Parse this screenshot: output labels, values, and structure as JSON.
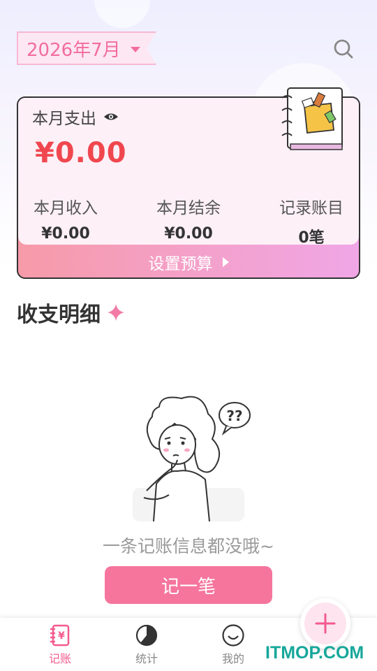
{
  "header": {
    "month": "2026年7月",
    "search_icon": "search-icon"
  },
  "summary": {
    "expense_label": "本月支出",
    "expense_value": "¥0.00",
    "income_label": "本月收入",
    "income_value": "¥0.00",
    "balance_label": "本月结余",
    "balance_value": "¥0.00",
    "records_label": "记录账目",
    "records_value": "0笔",
    "budget_label": "设置预算"
  },
  "details": {
    "title": "收支明细"
  },
  "empty_state": {
    "message": "一条记账信息都没哦~",
    "record_button": "记一笔"
  },
  "nav": {
    "items": [
      {
        "label": "记账",
        "icon": "ledger-icon",
        "active": true
      },
      {
        "label": "统计",
        "icon": "pie-chart-icon",
        "active": false
      },
      {
        "label": "我的",
        "icon": "smile-icon",
        "active": false
      }
    ],
    "fab_icon": "plus-icon"
  },
  "watermark": "ITMOP.COM",
  "colors": {
    "accent": "#f26d9f",
    "expense": "#f0474f",
    "button": "#f5759d"
  }
}
